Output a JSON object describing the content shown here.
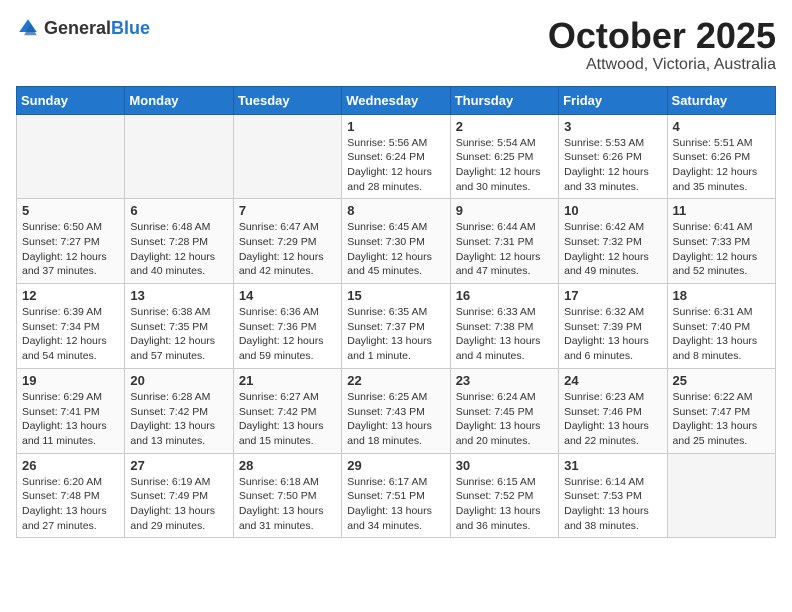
{
  "logo": {
    "general": "General",
    "blue": "Blue"
  },
  "title": {
    "month": "October 2025",
    "location": "Attwood, Victoria, Australia"
  },
  "weekdays": [
    "Sunday",
    "Monday",
    "Tuesday",
    "Wednesday",
    "Thursday",
    "Friday",
    "Saturday"
  ],
  "weeks": [
    [
      {
        "day": "",
        "info": ""
      },
      {
        "day": "",
        "info": ""
      },
      {
        "day": "",
        "info": ""
      },
      {
        "day": "1",
        "info": "Sunrise: 5:56 AM\nSunset: 6:24 PM\nDaylight: 12 hours\nand 28 minutes."
      },
      {
        "day": "2",
        "info": "Sunrise: 5:54 AM\nSunset: 6:25 PM\nDaylight: 12 hours\nand 30 minutes."
      },
      {
        "day": "3",
        "info": "Sunrise: 5:53 AM\nSunset: 6:26 PM\nDaylight: 12 hours\nand 33 minutes."
      },
      {
        "day": "4",
        "info": "Sunrise: 5:51 AM\nSunset: 6:26 PM\nDaylight: 12 hours\nand 35 minutes."
      }
    ],
    [
      {
        "day": "5",
        "info": "Sunrise: 6:50 AM\nSunset: 7:27 PM\nDaylight: 12 hours\nand 37 minutes."
      },
      {
        "day": "6",
        "info": "Sunrise: 6:48 AM\nSunset: 7:28 PM\nDaylight: 12 hours\nand 40 minutes."
      },
      {
        "day": "7",
        "info": "Sunrise: 6:47 AM\nSunset: 7:29 PM\nDaylight: 12 hours\nand 42 minutes."
      },
      {
        "day": "8",
        "info": "Sunrise: 6:45 AM\nSunset: 7:30 PM\nDaylight: 12 hours\nand 45 minutes."
      },
      {
        "day": "9",
        "info": "Sunrise: 6:44 AM\nSunset: 7:31 PM\nDaylight: 12 hours\nand 47 minutes."
      },
      {
        "day": "10",
        "info": "Sunrise: 6:42 AM\nSunset: 7:32 PM\nDaylight: 12 hours\nand 49 minutes."
      },
      {
        "day": "11",
        "info": "Sunrise: 6:41 AM\nSunset: 7:33 PM\nDaylight: 12 hours\nand 52 minutes."
      }
    ],
    [
      {
        "day": "12",
        "info": "Sunrise: 6:39 AM\nSunset: 7:34 PM\nDaylight: 12 hours\nand 54 minutes."
      },
      {
        "day": "13",
        "info": "Sunrise: 6:38 AM\nSunset: 7:35 PM\nDaylight: 12 hours\nand 57 minutes."
      },
      {
        "day": "14",
        "info": "Sunrise: 6:36 AM\nSunset: 7:36 PM\nDaylight: 12 hours\nand 59 minutes."
      },
      {
        "day": "15",
        "info": "Sunrise: 6:35 AM\nSunset: 7:37 PM\nDaylight: 13 hours\nand 1 minute."
      },
      {
        "day": "16",
        "info": "Sunrise: 6:33 AM\nSunset: 7:38 PM\nDaylight: 13 hours\nand 4 minutes."
      },
      {
        "day": "17",
        "info": "Sunrise: 6:32 AM\nSunset: 7:39 PM\nDaylight: 13 hours\nand 6 minutes."
      },
      {
        "day": "18",
        "info": "Sunrise: 6:31 AM\nSunset: 7:40 PM\nDaylight: 13 hours\nand 8 minutes."
      }
    ],
    [
      {
        "day": "19",
        "info": "Sunrise: 6:29 AM\nSunset: 7:41 PM\nDaylight: 13 hours\nand 11 minutes."
      },
      {
        "day": "20",
        "info": "Sunrise: 6:28 AM\nSunset: 7:42 PM\nDaylight: 13 hours\nand 13 minutes."
      },
      {
        "day": "21",
        "info": "Sunrise: 6:27 AM\nSunset: 7:42 PM\nDaylight: 13 hours\nand 15 minutes."
      },
      {
        "day": "22",
        "info": "Sunrise: 6:25 AM\nSunset: 7:43 PM\nDaylight: 13 hours\nand 18 minutes."
      },
      {
        "day": "23",
        "info": "Sunrise: 6:24 AM\nSunset: 7:45 PM\nDaylight: 13 hours\nand 20 minutes."
      },
      {
        "day": "24",
        "info": "Sunrise: 6:23 AM\nSunset: 7:46 PM\nDaylight: 13 hours\nand 22 minutes."
      },
      {
        "day": "25",
        "info": "Sunrise: 6:22 AM\nSunset: 7:47 PM\nDaylight: 13 hours\nand 25 minutes."
      }
    ],
    [
      {
        "day": "26",
        "info": "Sunrise: 6:20 AM\nSunset: 7:48 PM\nDaylight: 13 hours\nand 27 minutes."
      },
      {
        "day": "27",
        "info": "Sunrise: 6:19 AM\nSunset: 7:49 PM\nDaylight: 13 hours\nand 29 minutes."
      },
      {
        "day": "28",
        "info": "Sunrise: 6:18 AM\nSunset: 7:50 PM\nDaylight: 13 hours\nand 31 minutes."
      },
      {
        "day": "29",
        "info": "Sunrise: 6:17 AM\nSunset: 7:51 PM\nDaylight: 13 hours\nand 34 minutes."
      },
      {
        "day": "30",
        "info": "Sunrise: 6:15 AM\nSunset: 7:52 PM\nDaylight: 13 hours\nand 36 minutes."
      },
      {
        "day": "31",
        "info": "Sunrise: 6:14 AM\nSunset: 7:53 PM\nDaylight: 13 hours\nand 38 minutes."
      },
      {
        "day": "",
        "info": ""
      }
    ]
  ]
}
